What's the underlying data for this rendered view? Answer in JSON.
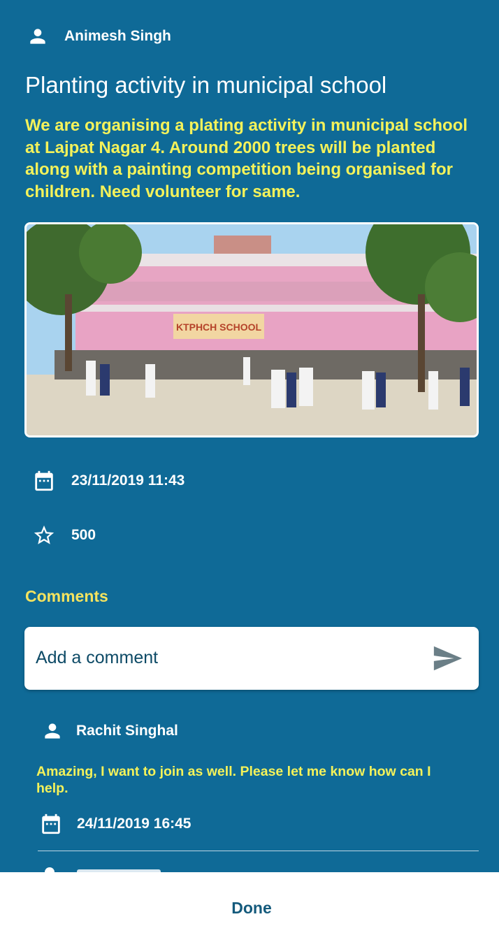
{
  "post": {
    "author": "Animesh Singh",
    "title": "Planting activity in municipal school",
    "description": "We are organising a plating activity in municipal school at Lajpat Nagar 4. Around 2000 trees will be planted along with a painting competition being organised for children. Need volunteer for same.",
    "datetime": "23/11/2019 11:43",
    "points": "500",
    "photo_sign_text": "KTPHCH SCHOOL"
  },
  "comments": {
    "heading": "Comments",
    "input_placeholder": "Add a comment",
    "items": [
      {
        "author": "Rachit Singhal",
        "text": "Amazing, I want to join as well. Please let me know how can I help.",
        "datetime": "24/11/2019 16:45"
      }
    ]
  },
  "footer": {
    "done_label": "Done"
  },
  "colors": {
    "background": "#0f6a97",
    "highlight_text": "#f4f25a",
    "heading_accent": "#f4e35f",
    "send_icon": "#6b7f87"
  },
  "icons": [
    "person-icon",
    "calendar-icon",
    "star-outline-icon",
    "send-icon"
  ]
}
